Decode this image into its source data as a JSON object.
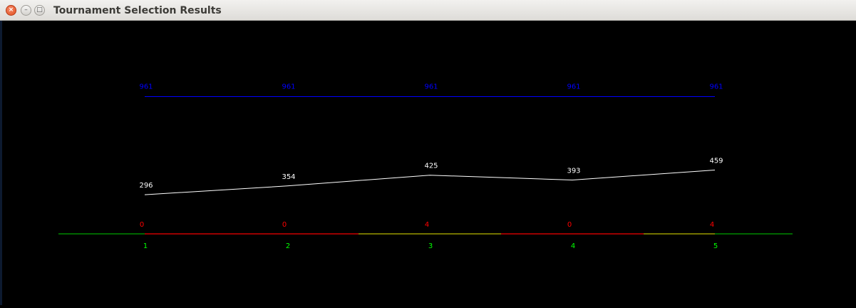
{
  "window": {
    "title": "Tournament Selection Results",
    "buttons": {
      "close_icon": "close-icon",
      "minimize_icon": "minimize-icon",
      "maximize_icon": "maximize-icon"
    },
    "close_glyph": "×",
    "minimize_glyph": "–",
    "maximize_glyph": "□"
  },
  "colors": {
    "background": "#000000",
    "top_series": "#0000ff",
    "middle_series": "#ffffff",
    "bottom_series": "#ff0000",
    "x_labels": "#00ff00",
    "axis_base": "#00cc00",
    "segment_zero": "#cc0000",
    "segment_nonzero": "#999900"
  },
  "chart_data": {
    "type": "line",
    "x": [
      1,
      2,
      3,
      4,
      5
    ],
    "x_labels": [
      "1",
      "2",
      "3",
      "4",
      "5"
    ],
    "series": [
      {
        "key": "top",
        "values": [
          961,
          961,
          961,
          961,
          961
        ],
        "labels": [
          "961",
          "961",
          "961",
          "961",
          "961"
        ]
      },
      {
        "key": "middle",
        "values": [
          296,
          354,
          425,
          393,
          459
        ],
        "labels": [
          "296",
          "354",
          "425",
          "393",
          "459"
        ]
      },
      {
        "key": "bottom",
        "values": [
          0,
          0,
          4,
          0,
          4
        ],
        "labels": [
          "0",
          "0",
          "4",
          "0",
          "4"
        ]
      }
    ]
  }
}
